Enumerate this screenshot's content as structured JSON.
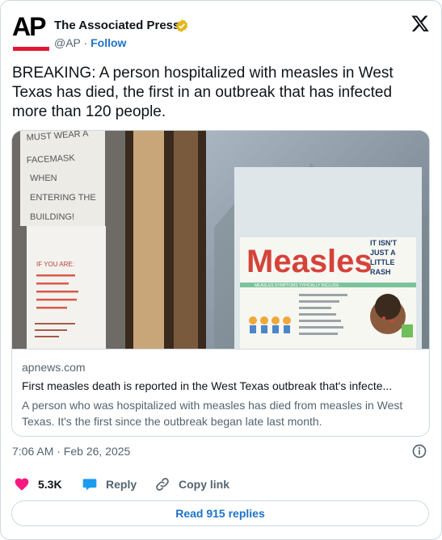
{
  "author": {
    "name": "The Associated Press",
    "handle": "@AP",
    "separator": "·",
    "follow_label": "Follow",
    "logo_text": "AP"
  },
  "tweet": {
    "text": "BREAKING: A person hospitalized with measles in West Texas has died, the first in an outbreak that has infected more than 120 people."
  },
  "photo": {
    "sign_left_lines": [
      "MUST WEAR A",
      "FACEMASK",
      "WHEN",
      "ENTERING THE",
      "BUILDING!"
    ],
    "sign_left_lower_title": "IF YOU ARE:",
    "poster_title": "Measles",
    "poster_tagline": [
      "IT ISN'T",
      "JUST A",
      "LITTLE",
      "RASH"
    ],
    "poster_strip": "MEASLES SYMPTOMS TYPICALLY INCLUDE"
  },
  "link_card": {
    "domain": "apnews.com",
    "title": "First measles death is reported in the West Texas outbreak that's infecte...",
    "description": "A person who was hospitalized with measles has died from measles in West Texas. It's the first since the outbreak began late last month."
  },
  "meta": {
    "timestamp": "7:06 AM · Feb 26, 2025"
  },
  "actions": {
    "likes": "5.3K",
    "reply_label": "Reply",
    "copy_link_label": "Copy link",
    "read_replies_label": "Read 915 replies"
  },
  "colors": {
    "like": "#f91880",
    "reply": "#1d9bf0",
    "accent": "#1d73c9",
    "ap_red": "#e31837",
    "verified_gold": "#e2b719"
  },
  "icons": [
    "verified-badge-icon",
    "x-logo-icon",
    "info-icon",
    "heart-icon",
    "reply-bubble-icon",
    "link-icon"
  ]
}
